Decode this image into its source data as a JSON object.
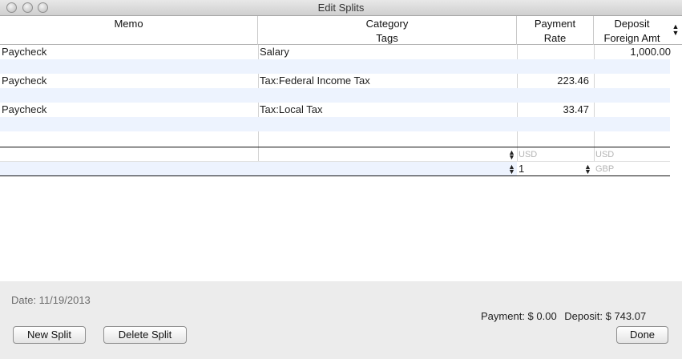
{
  "window": {
    "title": "Edit Splits"
  },
  "columns": {
    "memo": "Memo",
    "category": "Category",
    "tags": "Tags",
    "payment": "Payment",
    "rate": "Rate",
    "deposit": "Deposit",
    "foreign_amt": "Foreign Amt"
  },
  "rows": [
    {
      "memo": "Paycheck",
      "category": "Salary",
      "payment": "",
      "deposit": "1,000.00"
    },
    {
      "memo": "Paycheck",
      "category": "Tax:Federal Income Tax",
      "payment": "223.46",
      "deposit": ""
    },
    {
      "memo": "Paycheck",
      "category": "Tax:Local Tax",
      "payment": "33.47",
      "deposit": ""
    }
  ],
  "edit_row": {
    "payment_placeholder": "USD",
    "deposit_placeholder": "USD",
    "rate_value": "1",
    "foreign_placeholder": "GBP"
  },
  "footer": {
    "date": "Date: 11/19/2013",
    "payment_total": "Payment: $ 0.00",
    "deposit_total": "Deposit: $ 743.07"
  },
  "buttons": {
    "new_split": "New Split",
    "delete_split": "Delete Split",
    "done": "Done"
  }
}
